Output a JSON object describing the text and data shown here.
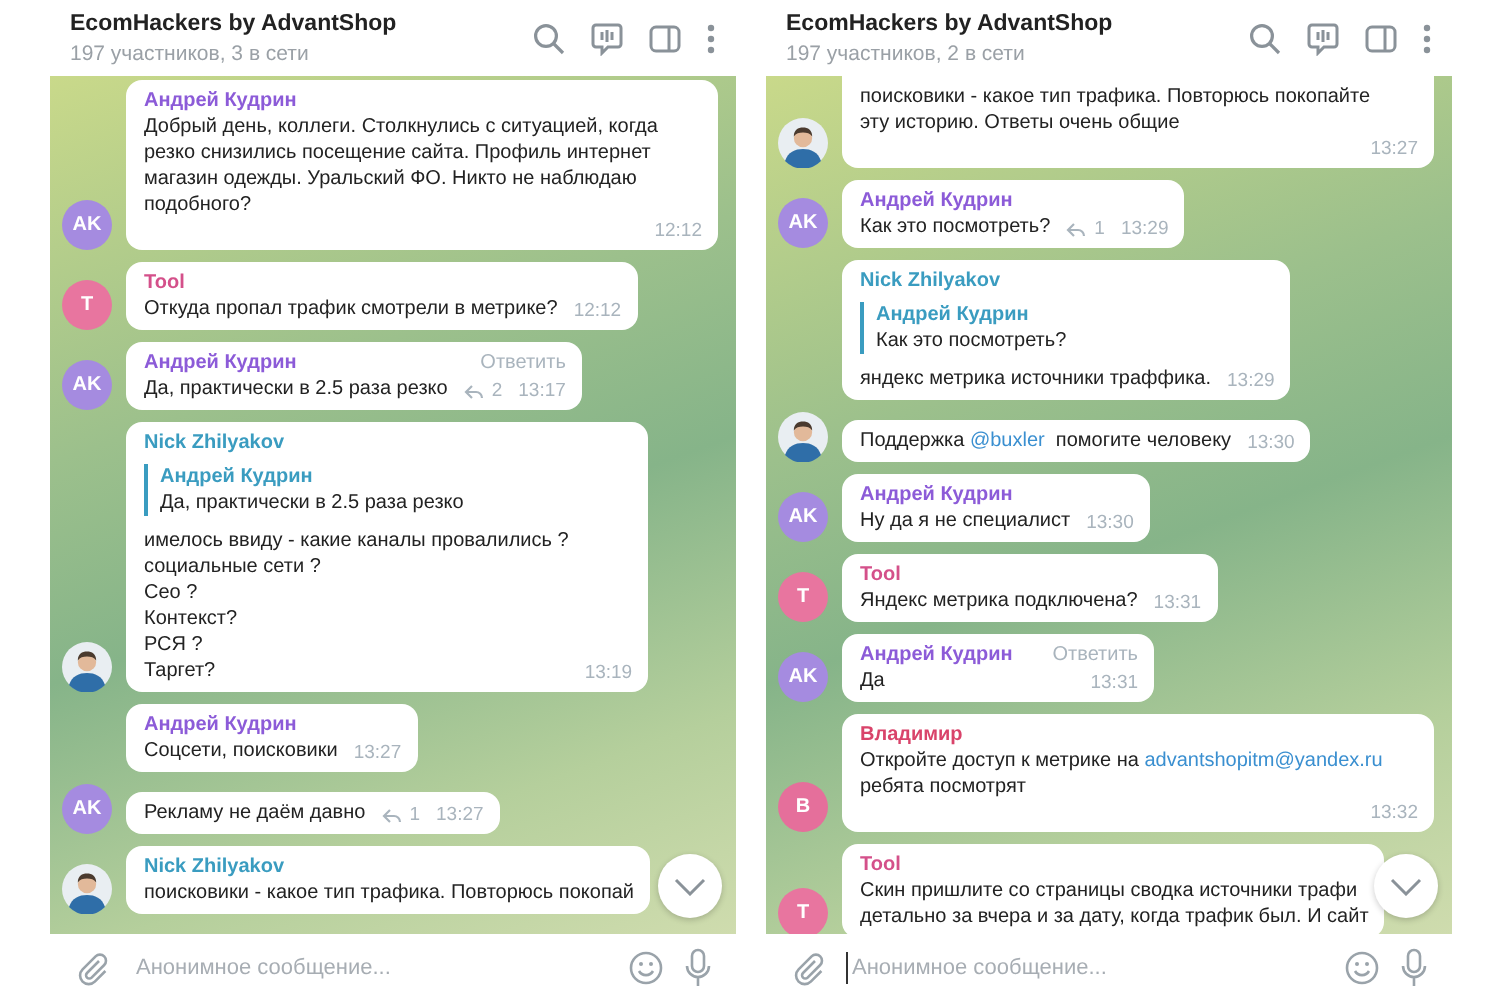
{
  "panels": [
    {
      "header": {
        "title": "EcomHackers by AdvantShop",
        "subtitle": "197 участников, 3 в сети"
      },
      "messages": [
        {
          "sender": "Андрей Кудрин",
          "color": "#8c5bd8",
          "text": "Добрый день, коллеги. Столкнулись с ситуацией, когда\nрезко снизились посещение сайта. Профиль интернет\nмагазин одежды. Уральский ФО. Никто не наблюдаю\nподобного?",
          "time": "12:12",
          "avatar": {
            "kind": "initials",
            "text": "AK",
            "color": "#a58be0"
          }
        },
        {
          "sender": "Tool",
          "color": "#d4508a",
          "text": "Откуда пропал трафик смотрели в метрике?",
          "time": "12:12",
          "avatar": {
            "kind": "initials",
            "text": "T",
            "color": "#e8759f"
          }
        },
        {
          "sender": "Андрей Кудрин",
          "color": "#8c5bd8",
          "action": "Ответить",
          "text": "Да, практически в 2.5 раза резко",
          "replies": "2",
          "time": "13:17",
          "avatar": {
            "kind": "initials",
            "text": "AK",
            "color": "#a58be0"
          }
        },
        {
          "sender": "Nick Zhilyakov",
          "color": "#3a9cc0",
          "quote": {
            "name": "Андрей Кудрин",
            "text": "Да, практически в 2.5 раза резко"
          },
          "text": "имелось ввиду - какие каналы провалились ?\nсоциальные сети ?\nСео ?\nКонтекст?\nРСЯ ?\nТаргет?",
          "time": "13:19",
          "avatar": {
            "kind": "photo"
          }
        },
        {
          "sender": "Андрей Кудрин",
          "color": "#8c5bd8",
          "text": "Соцсети, поисковики",
          "time": "13:27"
        },
        {
          "text": "Рекламу не даём давно",
          "replies": "1",
          "time": "13:27",
          "avatar": {
            "kind": "initials",
            "text": "AK",
            "color": "#a58be0"
          }
        },
        {
          "sender": "Nick Zhilyakov",
          "color": "#3a9cc0",
          "text": "поисковики - какое тип трафика. Повторюсь покопай",
          "avatar": {
            "kind": "photo"
          }
        }
      ],
      "composer": {
        "placeholder": "Анонимное сообщение...",
        "focused": false
      }
    },
    {
      "header": {
        "title": "EcomHackers by AdvantShop",
        "subtitle": "197 участников, 2 в сети"
      },
      "messages": [
        {
          "text": "поисковики - какое тип трафика. Повторюсь покопайте\nэту историю. Ответы очень общие",
          "time": "13:27",
          "avatar": {
            "kind": "photo"
          }
        },
        {
          "sender": "Андрей Кудрин",
          "color": "#8c5bd8",
          "text": "Как это посмотреть?",
          "replies": "1",
          "time": "13:29",
          "avatar": {
            "kind": "initials",
            "text": "AK",
            "color": "#a58be0"
          }
        },
        {
          "sender": "Nick Zhilyakov",
          "color": "#3a9cc0",
          "quote": {
            "name": "Андрей Кудрин",
            "text": "Как это посмотреть?"
          },
          "text": "яндекс метрика источники траффика.",
          "time": "13:29"
        },
        {
          "parts": [
            {
              "kind": "plain",
              "text": "Поддержка "
            },
            {
              "kind": "link",
              "text": "@buxler"
            },
            {
              "kind": "plain",
              "text": "  помогите человеку"
            }
          ],
          "time": "13:30",
          "avatar": {
            "kind": "photo"
          }
        },
        {
          "sender": "Андрей Кудрин",
          "color": "#8c5bd8",
          "text": "Ну да я не специалист",
          "time": "13:30",
          "avatar": {
            "kind": "initials",
            "text": "AK",
            "color": "#a58be0"
          }
        },
        {
          "sender": "Tool",
          "color": "#d4508a",
          "text": "Яндекс метрика подключена?",
          "time": "13:31",
          "avatar": {
            "kind": "initials",
            "text": "T",
            "color": "#e8759f"
          }
        },
        {
          "sender": "Андрей Кудрин",
          "color": "#8c5bd8",
          "action": "Ответить",
          "text": "Да",
          "time": "13:31",
          "avatar": {
            "kind": "initials",
            "text": "AK",
            "color": "#a58be0"
          }
        },
        {
          "sender": "Владимир",
          "color": "#d9436a",
          "parts": [
            {
              "kind": "plain",
              "text": "Откройте доступ к метрике на "
            },
            {
              "kind": "link",
              "text": "advantshopitm@yandex.ru"
            },
            {
              "kind": "plain",
              "text": "\nребята посмотрят"
            }
          ],
          "time": "13:32",
          "avatar": {
            "kind": "initials",
            "text": "В",
            "color": "#e56f9b"
          }
        },
        {
          "sender": "Tool",
          "color": "#d4508a",
          "text": "Скин пришлите со страницы сводка источники трафи\nдетально за вчера и за дату, когда трафик был. И сайт",
          "avatar": {
            "kind": "initials",
            "text": "T",
            "color": "#e8759f"
          }
        }
      ],
      "composer": {
        "placeholder": "Анонимное сообщение...",
        "focused": true
      }
    }
  ]
}
